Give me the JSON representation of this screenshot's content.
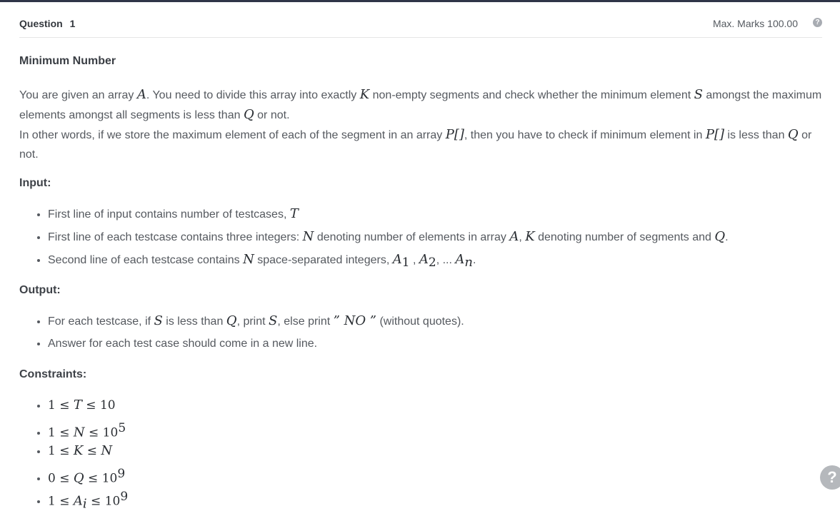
{
  "header": {
    "question_label": "Question",
    "question_number": "1",
    "max_marks": "Max. Marks 100.00",
    "help_icon": "?"
  },
  "problem": {
    "title": "Minimum Number",
    "p1_a": "You are given an array ",
    "p1_A": "A",
    "p1_b": ". You need to divide this array into exactly ",
    "p1_K": "K",
    "p1_c": " non-empty segments and check whether the minimum element ",
    "p1_S": "S",
    "p1_d": " amongst the maximum elements amongst all segments is less than ",
    "p1_Q": "Q",
    "p1_e": " or not.",
    "p2_a": "In other words, if we store the maximum element of each of the segment in an array ",
    "p2_P1": "P[]",
    "p2_b": ", then you have to check if minimum element in ",
    "p2_P2": "P[]",
    "p2_c": " is less than ",
    "p2_Q": "Q",
    "p2_d": " or not."
  },
  "input": {
    "heading": "Input:",
    "l1_a": "First line of input contains number of testcases, ",
    "l1_T": "T",
    "l2_a": "First line of each testcase contains three integers: ",
    "l2_N": "N",
    "l2_b": " denoting number of elements in array ",
    "l2_A": "A",
    "l2_c": ", ",
    "l2_K": "K",
    "l2_d": " denoting number of segments and ",
    "l2_Q": "Q",
    "l2_e": ".",
    "l3_a": "Second line of each testcase contains ",
    "l3_N": "N",
    "l3_b": " space-separated integers, ",
    "l3_A": "A",
    "l3_s1": "1",
    "l3_c": " , ",
    "l3_A2": "A",
    "l3_s2": "2",
    "l3_d": ", ... ",
    "l3_A3": "A",
    "l3_s3": "n",
    "l3_e": "."
  },
  "output": {
    "heading": "Output:",
    "l1_a": "For each testcase, if ",
    "l1_S": "S",
    "l1_b": " is less than ",
    "l1_Q": "Q",
    "l1_c": ", print ",
    "l1_S2": "S",
    "l1_d": ", else print ",
    "l1_NO": "” NO ”",
    "l1_e": " (without quotes).",
    "l2": "Answer for each test case should come in a new line."
  },
  "constraints": {
    "heading": "Constraints:",
    "c1_a": "1 ≤ ",
    "c1_v": "T",
    "c1_b": " ≤ 10",
    "c2_a": "1 ≤ ",
    "c2_v": "N",
    "c2_b": " ≤ 10",
    "c2_sup": "5",
    "c3_a": "1 ≤ ",
    "c3_v": "K",
    "c3_b": " ≤ ",
    "c3_v2": "N",
    "c4_a": "0 ≤ ",
    "c4_v": "Q",
    "c4_b": " ≤ 10",
    "c4_sup": "9",
    "c5_a": "1 ≤ ",
    "c5_v": "A",
    "c5_sub": "i",
    "c5_b": " ≤ 10",
    "c5_sup": "9"
  },
  "floating_help": "?"
}
